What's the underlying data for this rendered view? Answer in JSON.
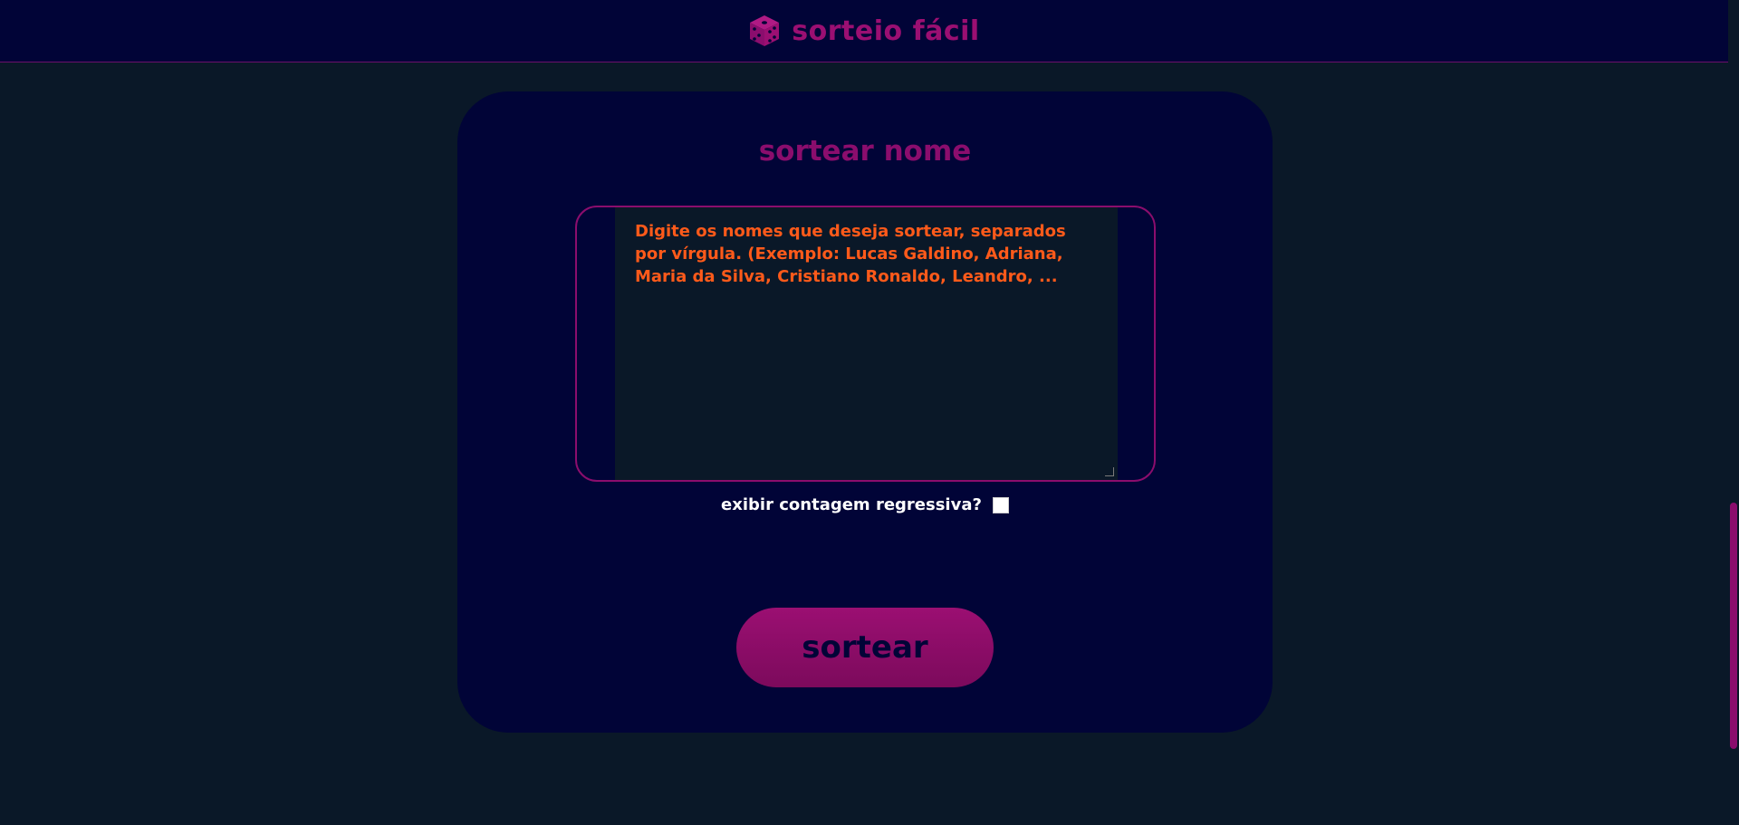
{
  "header": {
    "logo_icon": "dice-icon",
    "title": "sorteio fácil"
  },
  "card": {
    "title": "sortear nome",
    "names_input": {
      "value": "",
      "placeholder": "Digite os nomes que deseja sortear, separados por vírgula. (Exemplo: Lucas Galdino, Adriana, Maria da Silva, Cristiano Ronaldo, Leandro, ..."
    },
    "countdown": {
      "label": "exibir contagem regressiva?",
      "checked": false
    },
    "draw_button_label": "sortear"
  },
  "colors": {
    "page_bg": "#0a1828",
    "header_bg": "#010437",
    "card_bg": "#010437",
    "accent": "#8b0d6d",
    "placeholder_text": "#ff5a1a",
    "label_text": "#ffffff"
  }
}
